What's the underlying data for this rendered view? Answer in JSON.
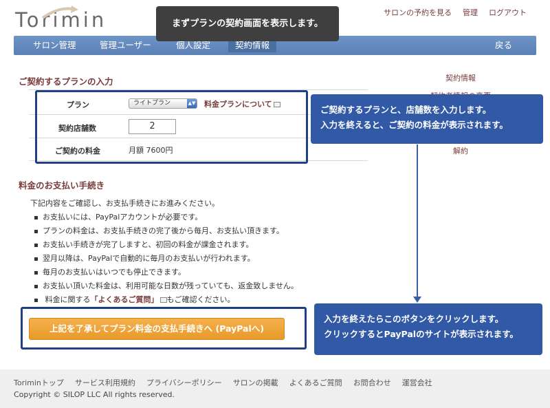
{
  "brand": {
    "logo_text": "Torimin"
  },
  "top_links": [
    "サロンの予約を見る",
    "管理",
    "ログアウト"
  ],
  "nav": {
    "items": [
      "サロン管理",
      "管理ユーザー",
      "個人設定",
      "契約情報"
    ],
    "back": "戻る",
    "active_index": 3
  },
  "tooltip_top": "まずプランの契約画面を表示します。",
  "plan_section": {
    "heading": "ご契約するプランの入力",
    "plan_label": "プラン",
    "plan_selected": "ライトプラン",
    "plan_link": "料金プランについて",
    "store_count_label": "契約店舗数",
    "store_count_value": "2",
    "fee_label": "ご契約の料金",
    "fee_value": "月額 7600円"
  },
  "side_menu": [
    "契約情報",
    "契約者情報の変更",
    "解約"
  ],
  "callout_1": {
    "line1": "ご契約するプランと、店舗数を入力します。",
    "line2": "入力を終えると、ご契約の料金が表示されます。"
  },
  "payment_section": {
    "heading": "料金のお支払い手続き",
    "intro": "下記内容をご確認し、お支払手続きにお進みください。",
    "bullets": [
      "お支払いには、PayPalアカウントが必要です。",
      "プランの料金は、お支払手続きの完了後から毎月、お支払い頂きます。",
      "お支払い手続きが完了しますと、初回の料金が課金されます。",
      "翌月以降は、PayPalで自動的に毎月のお支払いが行われます。",
      "毎月のお支払いはいつでも停止できます。",
      "お支払い頂いた料金は、利用可能な日数が残っていても、返金致しません。"
    ],
    "faq_prefix": "料金に関する",
    "faq_link": "「よくあるご質問」",
    "faq_suffix": "もご確認ください。",
    "button_label": "上記を了承してプラン料金の支払手続きへ (PayPalへ)"
  },
  "callout_2": {
    "line1": "入力を終えたらこのボタンをクリックします。",
    "line2": "クリックするとPayPalのサイトが表示されます。"
  },
  "footer": {
    "links": [
      "Toriminトップ",
      "サービス利用規約",
      "プライバシーポリシー",
      "サロンの掲載",
      "よくあるご質問",
      "お問合わせ",
      "運営会社"
    ],
    "copyright": "Copyright © SILOP LLC All rights reserved."
  },
  "colors": {
    "nav_blue": "#5f86bc",
    "callout_blue": "#3159a5",
    "frame_blue": "#1f3f86",
    "link_brown": "#7a3b3b",
    "button_orange": "#eea23a"
  }
}
